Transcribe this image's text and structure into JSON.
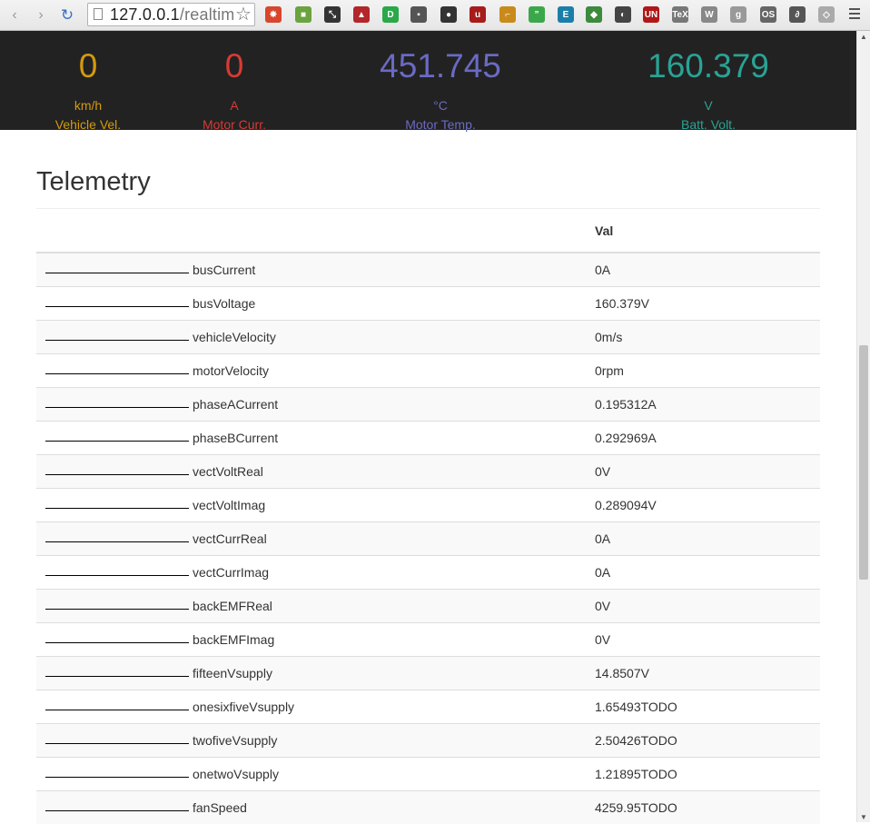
{
  "browser": {
    "url_host": "127.0.0.1",
    "url_path": "/realtim",
    "extensions": [
      {
        "name": "extension-burst-icon",
        "color": "#d8462b",
        "glyph": "✸"
      },
      {
        "name": "extension-box-icon",
        "color": "#6aa33f",
        "glyph": "■"
      },
      {
        "name": "extension-arrows-icon",
        "color": "#333333",
        "glyph": "⤡"
      },
      {
        "name": "extension-couch-icon",
        "color": "#b3262a",
        "glyph": "▲"
      },
      {
        "name": "extension-d-icon",
        "color": "#2aa84a",
        "glyph": "D"
      },
      {
        "name": "extension-plug-icon",
        "color": "#555555",
        "glyph": "▪"
      },
      {
        "name": "extension-glasses-icon",
        "color": "#333333",
        "glyph": "●"
      },
      {
        "name": "extension-ublock-icon",
        "color": "#a81b1b",
        "glyph": "u"
      },
      {
        "name": "extension-tool-icon",
        "color": "#c98a1c",
        "glyph": "⌐"
      },
      {
        "name": "extension-quote-icon",
        "color": "#3aa84a",
        "glyph": "”"
      },
      {
        "name": "extension-e-icon",
        "color": "#1a7fa8",
        "glyph": "E"
      },
      {
        "name": "extension-share-icon",
        "color": "#3c8a3c",
        "glyph": "◆"
      },
      {
        "name": "extension-mask-icon",
        "color": "#444444",
        "glyph": "◐"
      },
      {
        "name": "extension-un-icon",
        "color": "#b01818",
        "glyph": "UN"
      },
      {
        "name": "extension-tex-icon",
        "color": "#777777",
        "glyph": "TeX"
      },
      {
        "name": "extension-world-icon",
        "color": "#888888",
        "glyph": "W"
      },
      {
        "name": "extension-grey-icon",
        "color": "#999999",
        "glyph": "g"
      },
      {
        "name": "extension-os-icon",
        "color": "#666666",
        "glyph": "OS"
      },
      {
        "name": "extension-swirl-icon",
        "color": "#555555",
        "glyph": "∂"
      },
      {
        "name": "extension-shield-icon",
        "color": "#aaaaaa",
        "glyph": "◇"
      }
    ]
  },
  "dashboard": [
    {
      "value": "0",
      "unit": "km/h",
      "label": "Vehicle Vel.",
      "color": "#d49a0e"
    },
    {
      "value": "0",
      "unit": "A",
      "label": "Motor Curr.",
      "color": "#d83a34"
    },
    {
      "value": "451.745",
      "unit": "°C",
      "label": "Motor Temp.",
      "color": "#6a6ac4"
    },
    {
      "value": "160.379",
      "unit": "V",
      "label": "Batt. Volt.",
      "color": "#29a394"
    }
  ],
  "telemetry": {
    "title": "Telemetry",
    "columns": [
      "",
      "Val"
    ],
    "rows": [
      {
        "name": "busCurrent",
        "val": "0A"
      },
      {
        "name": "busVoltage",
        "val": "160.379V"
      },
      {
        "name": "vehicleVelocity",
        "val": "0m/s"
      },
      {
        "name": "motorVelocity",
        "val": "0rpm"
      },
      {
        "name": "phaseACurrent",
        "val": "0.195312A"
      },
      {
        "name": "phaseBCurrent",
        "val": "0.292969A"
      },
      {
        "name": "vectVoltReal",
        "val": "0V"
      },
      {
        "name": "vectVoltImag",
        "val": "0.289094V"
      },
      {
        "name": "vectCurrReal",
        "val": "0A"
      },
      {
        "name": "vectCurrImag",
        "val": "0A"
      },
      {
        "name": "backEMFReal",
        "val": "0V"
      },
      {
        "name": "backEMFImag",
        "val": "0V"
      },
      {
        "name": "fifteenVsupply",
        "val": "14.8507V"
      },
      {
        "name": "onesixfiveVsupply",
        "val": "1.65493TODO"
      },
      {
        "name": "twofiveVsupply",
        "val": "2.50426TODO"
      },
      {
        "name": "onetwoVsupply",
        "val": "1.21895TODO"
      },
      {
        "name": "fanSpeed",
        "val": "4259.95TODO"
      }
    ]
  }
}
